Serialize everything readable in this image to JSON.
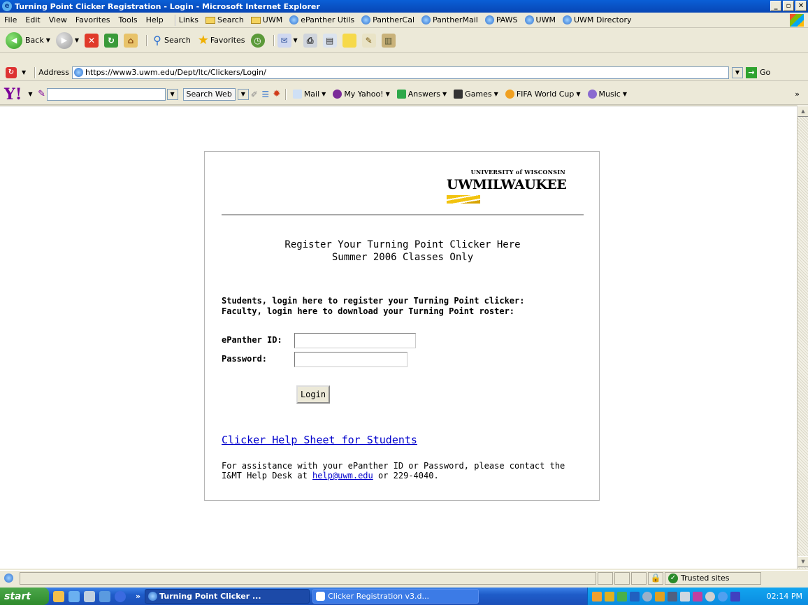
{
  "window": {
    "title": "Turning Point Clicker Registration - Login - Microsoft Internet Explorer"
  },
  "menubar": {
    "items": [
      "File",
      "Edit",
      "View",
      "Favorites",
      "Tools",
      "Help"
    ],
    "links_label": "Links",
    "links": [
      "Search",
      "UWM",
      "ePanther Utils",
      "PantherCal",
      "PantherMail",
      "PAWS",
      "UWM",
      "UWM Directory"
    ]
  },
  "toolbar": {
    "back": "Back",
    "search": "Search",
    "favorites": "Favorites"
  },
  "address": {
    "label": "Address",
    "url": "https://www3.uwm.edu/Dept/ltc/Clickers/Login/",
    "go": "Go"
  },
  "yahoo": {
    "logo": "Y!",
    "search_button": "Search Web",
    "items": [
      "Mail",
      "My Yahoo!",
      "Answers",
      "Games",
      "FIFA World Cup",
      "Music"
    ],
    "more": "»"
  },
  "logo": {
    "top": "UNIVERSITY of WISCONSIN",
    "main": "UWMILWAUKEE"
  },
  "page": {
    "heading_line1": "Register Your Turning Point Clicker Here",
    "heading_line2": "Summer 2006 Classes Only",
    "prompt_line1": "Students, login here to register your Turning Point clicker:",
    "prompt_line2": "Faculty, login here to download your Turning Point roster:",
    "epanther_label": "ePanther ID:",
    "password_label": "Password:",
    "epanther_value": "",
    "password_value": "",
    "login_button": "Login",
    "help_link": "Clicker Help Sheet for Students",
    "assist_line1": "For assistance with your ePanther ID or Password, please contact the",
    "assist_line2_prefix": "I&MT Help Desk at ",
    "assist_email": "help@uwm.edu",
    "assist_line2_suffix": " or 229-4040."
  },
  "statusbar": {
    "zone": "Trusted sites"
  },
  "taskbar": {
    "start": "start",
    "tasks": [
      "Turning Point Clicker ...",
      "Clicker Registration v3.d..."
    ],
    "clock": "02:14 PM"
  },
  "colors": {
    "title_bar": "#0a5fd6",
    "link": "#0000cc",
    "taskbar": "#1f5cc9",
    "start": "#2e8a2c"
  }
}
